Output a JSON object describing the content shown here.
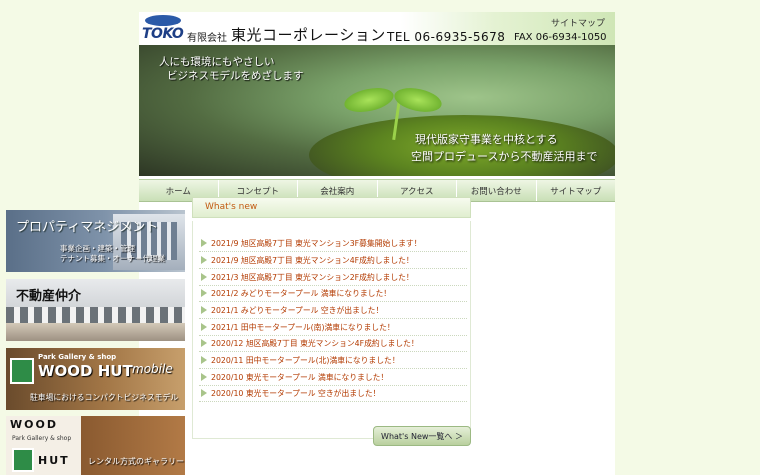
{
  "header": {
    "logo_text": "TOKO",
    "company_type": "有限会社",
    "company_name": "東光コーポレーション",
    "tel": "TEL 06-6935-5678",
    "fax": "FAX 06-6934-1050",
    "sitemap_link": "サイトマップ"
  },
  "hero": {
    "tagline_line1": "人にも環境にもやさしい",
    "tagline_line2": "ビジネスモデルをめざします",
    "subtext_line1": "現代版家守事業を中核とする",
    "subtext_line2": "空間プロデュースから不動産活用まで"
  },
  "nav": {
    "items": [
      {
        "label": "ホーム"
      },
      {
        "label": "コンセプト"
      },
      {
        "label": "会社案内"
      },
      {
        "label": "アクセス"
      },
      {
        "label": "お問い合わせ"
      },
      {
        "label": "サイトマップ"
      }
    ]
  },
  "banners": {
    "property": {
      "title": "プロパティマネジメント",
      "line1": "事業企画・建築・管理",
      "line2": "テナント募集・オーナー代理業"
    },
    "realestate": {
      "title": "不動産仲介"
    },
    "woodhut_mobile": {
      "shop": "Park Gallery & shop",
      "name": "WOOD HUT",
      "mobile": "mobile",
      "caption": "駐車場におけるコンパクトビジネスモデル"
    },
    "woodhut": {
      "word1": "WOOD",
      "gallery": "Park Gallery & shop",
      "word2": "HUT",
      "caption": "レンタル方式のギャラリー"
    }
  },
  "whats_new": {
    "title": "What's new",
    "items": [
      "2021/9  旭区高殿7丁目 東光マンション3F募集開始します！",
      "2021/9  旭区高殿7丁目 東光マンション4F成約しました！",
      "2021/3  旭区高殿7丁目 東光マンション2F成約しました！",
      "2021/2  みどりモータープール 満車になりました！",
      "2021/1   みどりモータープール 空きが出ました！",
      "2021/1  田中モータープール(南)満車になりました！",
      "2020/12  旭区高殿7丁目 東光マンション4F成約しました！",
      "2020/11 田中モータープール(北)満車になりました！",
      "2020/10 東光モータープール 満車になりました！",
      "2020/10 東光モータープール  空きが出ました！"
    ],
    "more_label": "What's New一覧へ ＞"
  },
  "colors": {
    "page_bg": "#f4fae6",
    "news_text": "#b33a00",
    "nav_bg": "#c9dfb6",
    "accent_orange": "#c25b12"
  }
}
